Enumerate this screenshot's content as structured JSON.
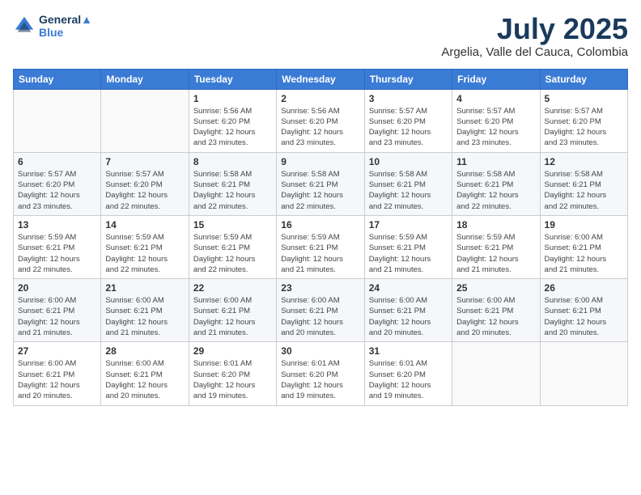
{
  "logo": {
    "line1": "General",
    "line2": "Blue"
  },
  "title": "July 2025",
  "location": "Argelia, Valle del Cauca, Colombia",
  "weekdays": [
    "Sunday",
    "Monday",
    "Tuesday",
    "Wednesday",
    "Thursday",
    "Friday",
    "Saturday"
  ],
  "weeks": [
    [
      {
        "day": "",
        "info": ""
      },
      {
        "day": "",
        "info": ""
      },
      {
        "day": "1",
        "info": "Sunrise: 5:56 AM\nSunset: 6:20 PM\nDaylight: 12 hours\nand 23 minutes."
      },
      {
        "day": "2",
        "info": "Sunrise: 5:56 AM\nSunset: 6:20 PM\nDaylight: 12 hours\nand 23 minutes."
      },
      {
        "day": "3",
        "info": "Sunrise: 5:57 AM\nSunset: 6:20 PM\nDaylight: 12 hours\nand 23 minutes."
      },
      {
        "day": "4",
        "info": "Sunrise: 5:57 AM\nSunset: 6:20 PM\nDaylight: 12 hours\nand 23 minutes."
      },
      {
        "day": "5",
        "info": "Sunrise: 5:57 AM\nSunset: 6:20 PM\nDaylight: 12 hours\nand 23 minutes."
      }
    ],
    [
      {
        "day": "6",
        "info": "Sunrise: 5:57 AM\nSunset: 6:20 PM\nDaylight: 12 hours\nand 23 minutes."
      },
      {
        "day": "7",
        "info": "Sunrise: 5:57 AM\nSunset: 6:20 PM\nDaylight: 12 hours\nand 22 minutes."
      },
      {
        "day": "8",
        "info": "Sunrise: 5:58 AM\nSunset: 6:21 PM\nDaylight: 12 hours\nand 22 minutes."
      },
      {
        "day": "9",
        "info": "Sunrise: 5:58 AM\nSunset: 6:21 PM\nDaylight: 12 hours\nand 22 minutes."
      },
      {
        "day": "10",
        "info": "Sunrise: 5:58 AM\nSunset: 6:21 PM\nDaylight: 12 hours\nand 22 minutes."
      },
      {
        "day": "11",
        "info": "Sunrise: 5:58 AM\nSunset: 6:21 PM\nDaylight: 12 hours\nand 22 minutes."
      },
      {
        "day": "12",
        "info": "Sunrise: 5:58 AM\nSunset: 6:21 PM\nDaylight: 12 hours\nand 22 minutes."
      }
    ],
    [
      {
        "day": "13",
        "info": "Sunrise: 5:59 AM\nSunset: 6:21 PM\nDaylight: 12 hours\nand 22 minutes."
      },
      {
        "day": "14",
        "info": "Sunrise: 5:59 AM\nSunset: 6:21 PM\nDaylight: 12 hours\nand 22 minutes."
      },
      {
        "day": "15",
        "info": "Sunrise: 5:59 AM\nSunset: 6:21 PM\nDaylight: 12 hours\nand 22 minutes."
      },
      {
        "day": "16",
        "info": "Sunrise: 5:59 AM\nSunset: 6:21 PM\nDaylight: 12 hours\nand 21 minutes."
      },
      {
        "day": "17",
        "info": "Sunrise: 5:59 AM\nSunset: 6:21 PM\nDaylight: 12 hours\nand 21 minutes."
      },
      {
        "day": "18",
        "info": "Sunrise: 5:59 AM\nSunset: 6:21 PM\nDaylight: 12 hours\nand 21 minutes."
      },
      {
        "day": "19",
        "info": "Sunrise: 6:00 AM\nSunset: 6:21 PM\nDaylight: 12 hours\nand 21 minutes."
      }
    ],
    [
      {
        "day": "20",
        "info": "Sunrise: 6:00 AM\nSunset: 6:21 PM\nDaylight: 12 hours\nand 21 minutes."
      },
      {
        "day": "21",
        "info": "Sunrise: 6:00 AM\nSunset: 6:21 PM\nDaylight: 12 hours\nand 21 minutes."
      },
      {
        "day": "22",
        "info": "Sunrise: 6:00 AM\nSunset: 6:21 PM\nDaylight: 12 hours\nand 21 minutes."
      },
      {
        "day": "23",
        "info": "Sunrise: 6:00 AM\nSunset: 6:21 PM\nDaylight: 12 hours\nand 20 minutes."
      },
      {
        "day": "24",
        "info": "Sunrise: 6:00 AM\nSunset: 6:21 PM\nDaylight: 12 hours\nand 20 minutes."
      },
      {
        "day": "25",
        "info": "Sunrise: 6:00 AM\nSunset: 6:21 PM\nDaylight: 12 hours\nand 20 minutes."
      },
      {
        "day": "26",
        "info": "Sunrise: 6:00 AM\nSunset: 6:21 PM\nDaylight: 12 hours\nand 20 minutes."
      }
    ],
    [
      {
        "day": "27",
        "info": "Sunrise: 6:00 AM\nSunset: 6:21 PM\nDaylight: 12 hours\nand 20 minutes."
      },
      {
        "day": "28",
        "info": "Sunrise: 6:00 AM\nSunset: 6:21 PM\nDaylight: 12 hours\nand 20 minutes."
      },
      {
        "day": "29",
        "info": "Sunrise: 6:01 AM\nSunset: 6:20 PM\nDaylight: 12 hours\nand 19 minutes."
      },
      {
        "day": "30",
        "info": "Sunrise: 6:01 AM\nSunset: 6:20 PM\nDaylight: 12 hours\nand 19 minutes."
      },
      {
        "day": "31",
        "info": "Sunrise: 6:01 AM\nSunset: 6:20 PM\nDaylight: 12 hours\nand 19 minutes."
      },
      {
        "day": "",
        "info": ""
      },
      {
        "day": "",
        "info": ""
      }
    ]
  ]
}
